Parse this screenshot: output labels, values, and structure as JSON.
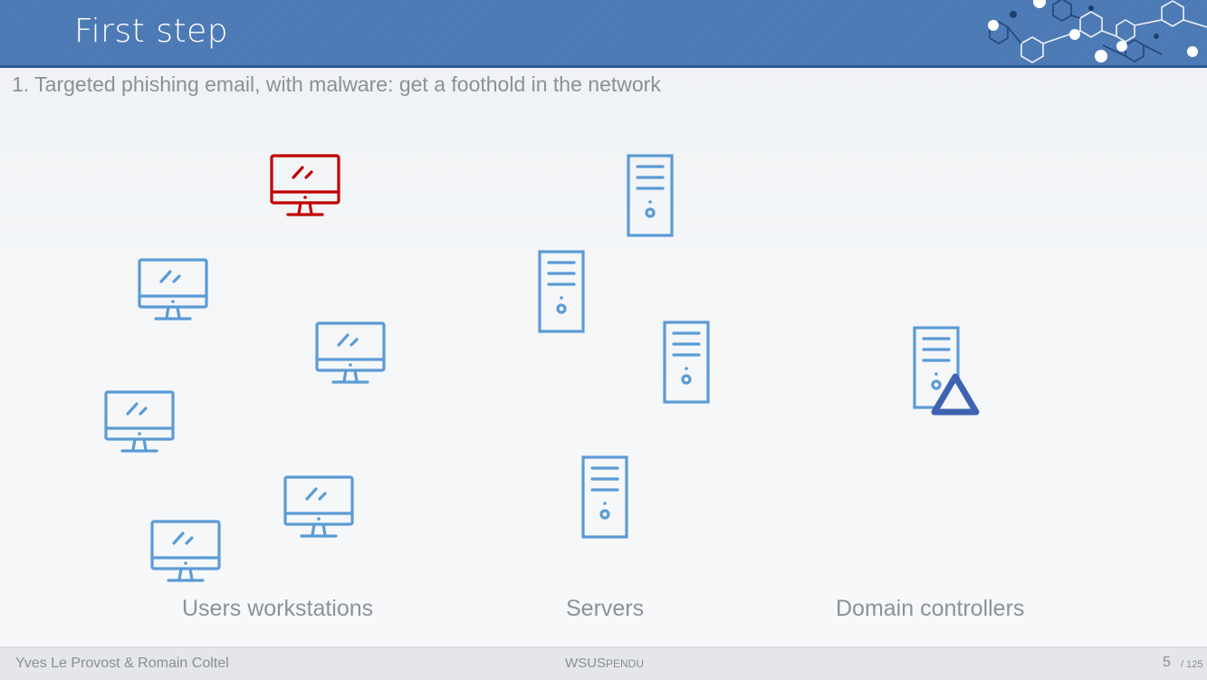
{
  "slide": {
    "title": "First step",
    "subtitle": "1. Targeted phishing email, with malware: get a foothold in the network"
  },
  "labels": {
    "workstations": "Users workstations",
    "servers": "Servers",
    "domain_controllers": "Domain controllers"
  },
  "footer": {
    "authors": "Yves Le Provost & Romain Coltel",
    "project_prefix": "WSUS",
    "project_suffix": "PENDU",
    "page": "5",
    "total": "/ 125"
  },
  "colors": {
    "header_blue": "#4b78b2",
    "icon_blue": "#5b9bd5",
    "compromised_red": "#c00000",
    "dc_triangle": "#3f63b0"
  },
  "icons": {
    "workstation": "monitor-icon",
    "server": "server-tower-icon",
    "domain_controller_badge": "triangle-badge-icon"
  }
}
